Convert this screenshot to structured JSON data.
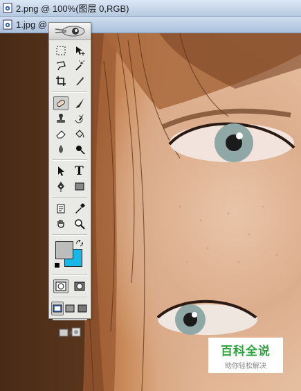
{
  "windows": [
    {
      "title": "2.png @ 100%(图层 0,RGB)"
    },
    {
      "title": "1.jpg @"
    }
  ],
  "toolbox": {
    "rows": [
      [
        "marquee-tool-icon",
        "move-tool-icon"
      ],
      [
        "lasso-tool-icon",
        "magic-wand-tool-icon"
      ],
      [
        "crop-tool-icon",
        "slice-tool-icon"
      ],
      [
        "healing-brush-tool-icon",
        "brush-tool-icon"
      ],
      [
        "clone-stamp-tool-icon",
        "history-brush-tool-icon"
      ],
      [
        "eraser-tool-icon",
        "paint-bucket-tool-icon"
      ],
      [
        "blur-tool-icon",
        "dodge-tool-icon"
      ],
      [
        "path-selection-tool-icon",
        "type-tool-icon"
      ],
      [
        "pen-tool-icon",
        "rectangle-tool-icon"
      ],
      [
        "notes-tool-icon",
        "eyedropper-tool-icon"
      ],
      [
        "hand-tool-icon",
        "zoom-tool-icon"
      ]
    ],
    "type_tool_glyph": "T",
    "foreground_color": "#bdbdbd",
    "background_color": "#18b7e8"
  },
  "watermark": {
    "title": "百科全说",
    "subtitle": "助你轻松解决",
    "color": "#2ea23c"
  }
}
